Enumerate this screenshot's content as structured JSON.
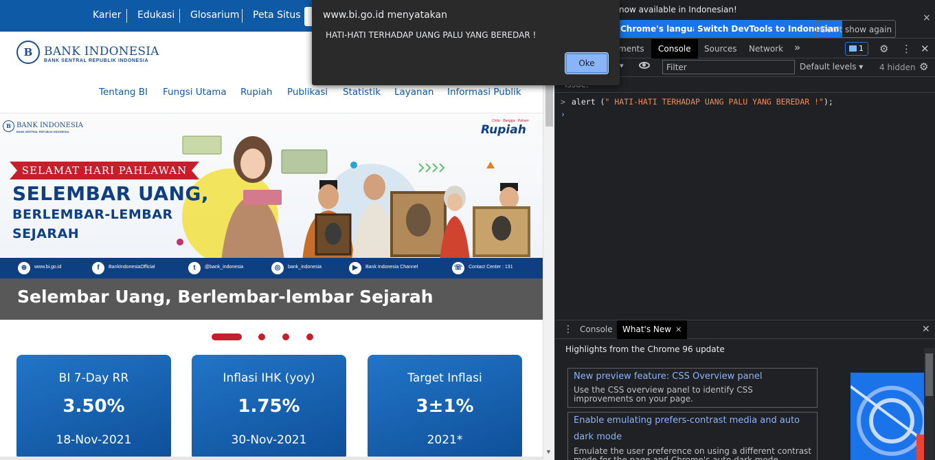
{
  "site": {
    "top_links": [
      "Karier",
      "Edukasi",
      "Glosarium",
      "Peta Situs"
    ],
    "logo": {
      "name": "BANK INDONESIA",
      "subtitle": "BANK SENTRAL REPUBLIK INDONESIA",
      "mark": "B"
    },
    "nav": [
      "Tentang BI",
      "Fungsi Utama",
      "Rupiah",
      "Publikasi",
      "Statistik",
      "Layanan",
      "Informasi Publik"
    ],
    "banner": {
      "logo_name": "BANK INDONESIA",
      "logo_sub": "BANK SENTRAL REPUBLIK INDONESIA",
      "ribbon": "SELAMAT HARI PAHLAWAN",
      "headline_1": "SELEMBAR UANG,",
      "headline_2": "BERLEMBAR-LEMBAR",
      "headline_3": "SEJARAH",
      "rupiah_tagline": "Cinta · Bangga · Paham",
      "rupiah_word": "Rupiah",
      "footer": [
        {
          "icon": "globe-icon",
          "glyph": "⊕",
          "text": "www.bi.go.id"
        },
        {
          "icon": "facebook-icon",
          "glyph": "f",
          "text": "BankIndonesiaOfficial"
        },
        {
          "icon": "twitter-icon",
          "glyph": "t",
          "text": "@bank_indonesia"
        },
        {
          "icon": "instagram-icon",
          "glyph": "◎",
          "text": "bank_indonesia"
        },
        {
          "icon": "youtube-icon",
          "glyph": "▶",
          "text": "Bank Indonesia Channel"
        },
        {
          "icon": "phone-icon",
          "glyph": "☏",
          "text": "Contact Center : 131"
        }
      ]
    },
    "caption": "Selembar Uang, Berlembar-lembar Sejarah",
    "carousel": {
      "slides": 4,
      "active": 1
    },
    "stats": [
      {
        "label": "BI 7-Day RR",
        "value": "3.50%",
        "date": "18-Nov-2021"
      },
      {
        "label": "Inflasi IHK (yoy)",
        "value": "1.75%",
        "date": "30-Nov-2021"
      },
      {
        "label": "Target Inflasi",
        "value": "3±1%",
        "date": "2021*"
      }
    ],
    "colors": {
      "brand_blue": "#0f5aa6",
      "brand_red": "#c61e2b",
      "caption_bg": "#585858"
    }
  },
  "alert": {
    "origin": "www.bi.go.id menyatakan",
    "message": "HATI-HATI TERHADAP UANG PALU YANG BEREDAR !",
    "ok_label": "Oke"
  },
  "devtools": {
    "infobar": {
      "message": "now available in Indonesian!",
      "btn_language": "Chrome's language",
      "btn_switch": "Switch DevTools to Indonesian",
      "btn_dont_show": "Don't show again"
    },
    "tabs": [
      {
        "label": "ments",
        "active": false
      },
      {
        "label": "Console",
        "active": true
      },
      {
        "label": "Sources",
        "active": false
      },
      {
        "label": "Network",
        "active": false
      }
    ],
    "more_tabs_glyph": "»",
    "issues_count": "1",
    "filter_placeholder": "Filter",
    "levels_label": "Default levels ▾",
    "hidden_label": "4 hidden",
    "issue_bar": "Issue:",
    "console_lines": [
      {
        "prompt": ">",
        "code_pre": "alert (",
        "code_str": "\" HATI-HATI TERHADAP UANG PALU YANG BEREDAR !\"",
        "code_post": ");"
      }
    ],
    "drawer": {
      "tabs": [
        {
          "label": "Console",
          "active": false
        },
        {
          "label": "What's New",
          "active": true
        }
      ],
      "heading": "Highlights from the Chrome 96 update",
      "cards": [
        {
          "title": "New preview feature: CSS Overview panel",
          "desc": "Use the CSS overview panel to identify CSS improvements on your page."
        },
        {
          "title": "Enable emulating prefers-contrast media and auto dark mode",
          "desc": "Emulate the user preference on using a different contrast mode for the page and Chrome's auto dark mode."
        }
      ]
    },
    "colors": {
      "bg": "#202124",
      "accent": "#1a73e8",
      "string": "#f28b54",
      "link": "#8ab4f8"
    }
  }
}
